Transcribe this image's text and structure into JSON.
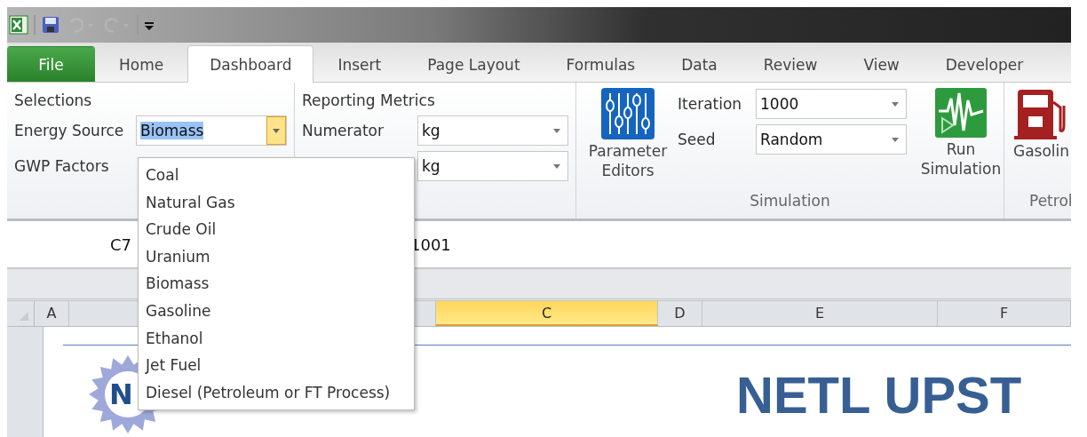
{
  "quick_access": [
    {
      "kind": "app"
    },
    {
      "kind": "save"
    },
    {
      "kind": "undo",
      "disabled": true
    },
    {
      "kind": "redo",
      "disabled": true
    },
    {
      "kind": "customize"
    }
  ],
  "tabs": [
    {
      "label": "File",
      "kind": "file",
      "selected": false
    },
    {
      "label": "Home",
      "kind": "tab",
      "selected": false
    },
    {
      "label": "Dashboard",
      "kind": "tab",
      "selected": true
    },
    {
      "label": "Insert",
      "kind": "tab",
      "selected": false
    },
    {
      "label": "Page Layout",
      "kind": "tab",
      "selected": false
    },
    {
      "label": "Formulas",
      "kind": "tab",
      "selected": false
    },
    {
      "label": "Data",
      "kind": "tab",
      "selected": false
    },
    {
      "label": "Review",
      "kind": "tab",
      "selected": false
    },
    {
      "label": "View",
      "kind": "tab",
      "selected": false
    },
    {
      "label": "Developer",
      "kind": "tab",
      "selected": false
    }
  ],
  "ribbon": {
    "selections": {
      "title": "Selections",
      "fields": [
        {
          "label": "Energy Source",
          "value": "Biomass",
          "open": true
        },
        {
          "label": "GWP Factors"
        }
      ]
    },
    "reporting_metrics": {
      "title": "Reporting Metrics",
      "fields": [
        {
          "label": "Numerator",
          "value": "kg"
        },
        {
          "value": "kg"
        }
      ]
    },
    "simulation": {
      "title": "Simulation",
      "parameter_button": "Parameter Editors",
      "fields": [
        {
          "label": "Iteration",
          "value": "1000"
        },
        {
          "label": "Seed",
          "value": "Random"
        }
      ],
      "run_button": "Run Simulation"
    },
    "petrol": {
      "title": "Petrol",
      "button": "Gasolin"
    }
  },
  "dropdown": {
    "options": [
      {
        "label": "Coal"
      },
      {
        "label": "Natural Gas"
      },
      {
        "label": "Crude Oil"
      },
      {
        "label": "Uranium"
      },
      {
        "label": "Biomass"
      },
      {
        "label": "Gasoline"
      },
      {
        "label": "Ethanol"
      },
      {
        "label": "Jet Fuel"
      },
      {
        "label": "Diesel (Petroleum or FT Process)"
      }
    ]
  },
  "formula_bar": {
    "name_box": "C7",
    "formula": "1001"
  },
  "columns": [
    {
      "label": "A",
      "selected": false
    },
    {
      "label": "C",
      "selected": true
    },
    {
      "label": "D",
      "selected": false
    },
    {
      "label": "E",
      "selected": false
    },
    {
      "label": "F",
      "selected": false
    }
  ],
  "sheet": {
    "logo_text": "N",
    "title": "NETL UPST"
  }
}
